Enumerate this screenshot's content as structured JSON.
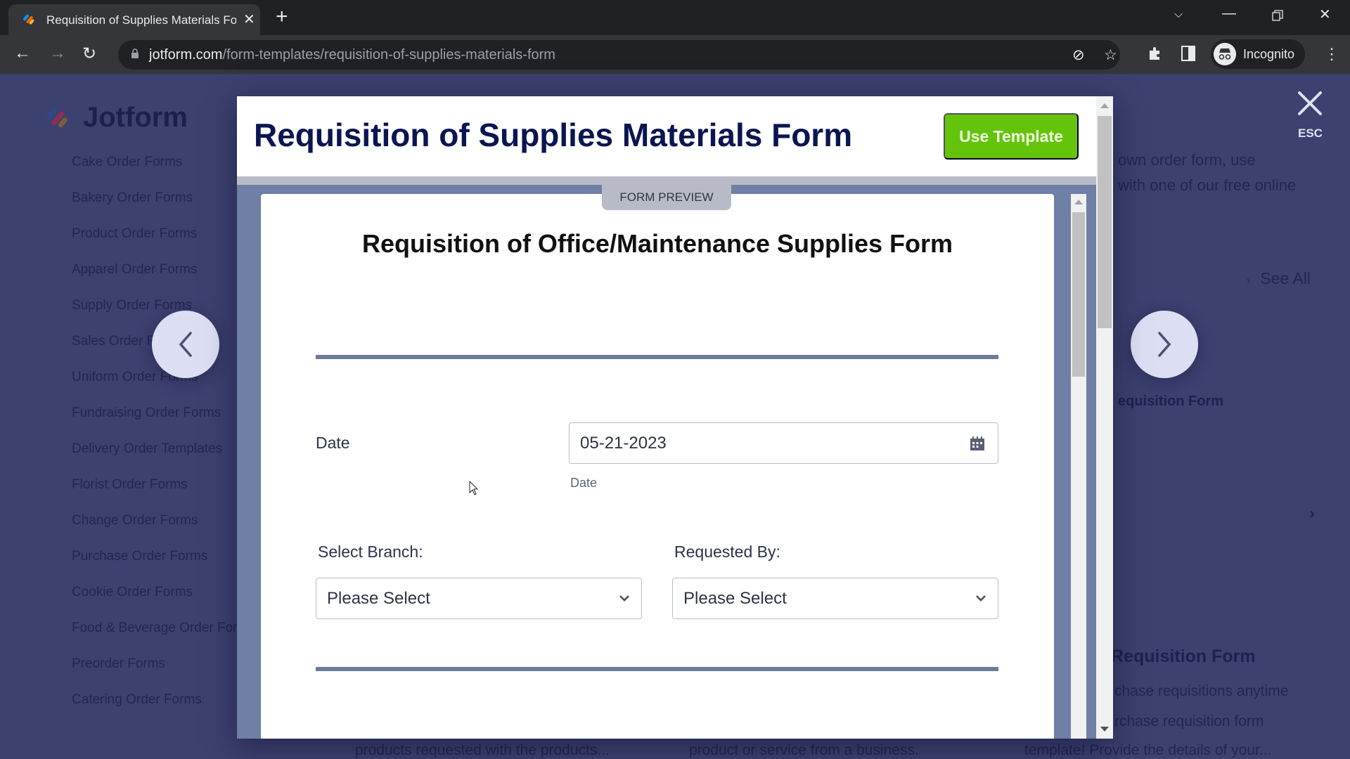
{
  "browser": {
    "tab_title": "Requisition of Supplies Materials Form | Jotform",
    "new_tab_icon": "plus-icon",
    "url_host": "jotform.com",
    "url_path": "/form-templates/requisition-of-supplies-materials-form",
    "profile_label": "Incognito",
    "icons": [
      "back-arrow-icon",
      "forward-arrow-icon",
      "reload-icon",
      "lock-icon",
      "eye-off-icon",
      "star-icon",
      "puzzle-icon",
      "side-panel-icon",
      "incognito-icon",
      "kebab-menu-icon",
      "tab-search-icon",
      "minimize-icon",
      "restore-icon",
      "window-close-icon"
    ]
  },
  "background_page": {
    "logo_text": "Jotform",
    "categories": [
      "Cake Order Forms",
      "Bakery Order Forms",
      "Product Order Forms",
      "Apparel Order Forms",
      "Supply Order Forms",
      "Sales Order Forms",
      "Uniform Order Forms",
      "Fundraising Order Forms",
      "Delivery Order Templates",
      "Florist Order Forms",
      "Change Order Forms",
      "Purchase Order Forms",
      "Cookie Order Forms",
      "Food & Beverage Order Forms",
      "Preorder Forms",
      "Catering Order Forms"
    ],
    "intro_line_1": "own order form, use",
    "intro_line_2": "with one of our free online",
    "see_all": "See All",
    "card_title_1": "equisition Form",
    "card_title_2": "Requisition Form",
    "card_desc_2_line1": "chase requisitions anytime",
    "card_desc_2_line2": "rchase requisition form",
    "card_desc_2_line3": "template! Provide the details of your...",
    "bottom_desc_1": "products requested with the products...",
    "bottom_desc_2": "product or service from a business."
  },
  "overlay": {
    "close_label": "ESC",
    "prev_icon": "chevron-left-icon",
    "next_icon": "chevron-right-icon"
  },
  "modal": {
    "title": "Requisition of Supplies Materials Form",
    "use_template_label": "Use Template",
    "preview_tab_label": "FORM PREVIEW",
    "form": {
      "title": "Requisition of Office/Maintenance Supplies Form",
      "date_label": "Date",
      "date_value": "05-21-2023",
      "date_sublabel": "Date",
      "branch_label": "Select Branch:",
      "branch_value": "Please Select",
      "requested_by_label": "Requested By:",
      "requested_by_value": "Please Select"
    }
  },
  "colors": {
    "accent_green": "#64c40c",
    "title_navy": "#0a1551",
    "preview_bg": "#6f7fa5"
  }
}
